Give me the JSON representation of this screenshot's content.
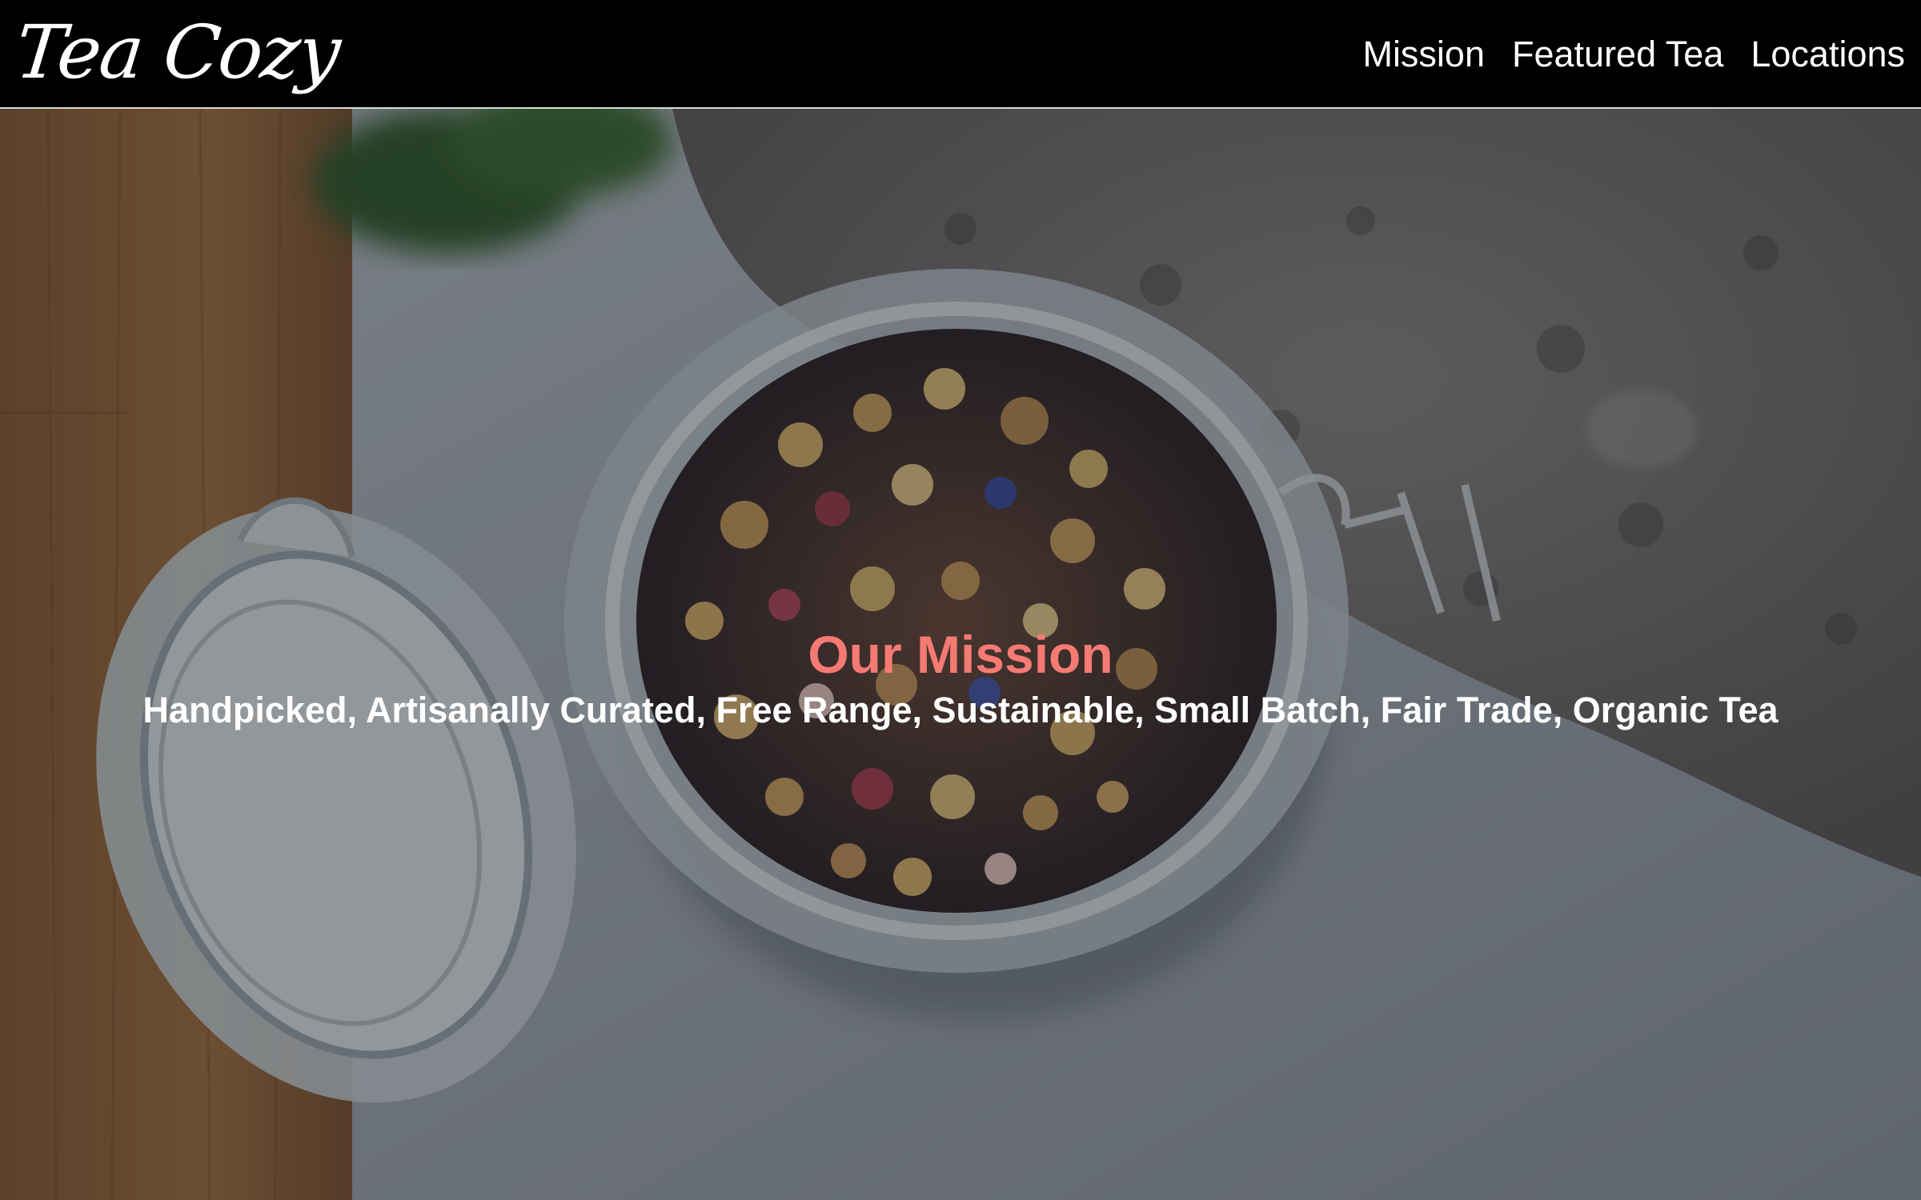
{
  "brand": {
    "logo_text": "Tea Cozy"
  },
  "nav": {
    "items": [
      "Mission",
      "Featured Tea",
      "Locations"
    ]
  },
  "hero": {
    "image_alt": "Open glass jar of loose leaf tea on a table",
    "heading": "Our Mission",
    "subheading": "Handpicked, Artisanally Curated, Free Range, Sustainable, Small Batch, Fair Trade, Organic Tea"
  },
  "colors": {
    "heading": "#f57a74",
    "nav_text": "#ffffff",
    "header_bg": "#000000"
  },
  "icons": {}
}
